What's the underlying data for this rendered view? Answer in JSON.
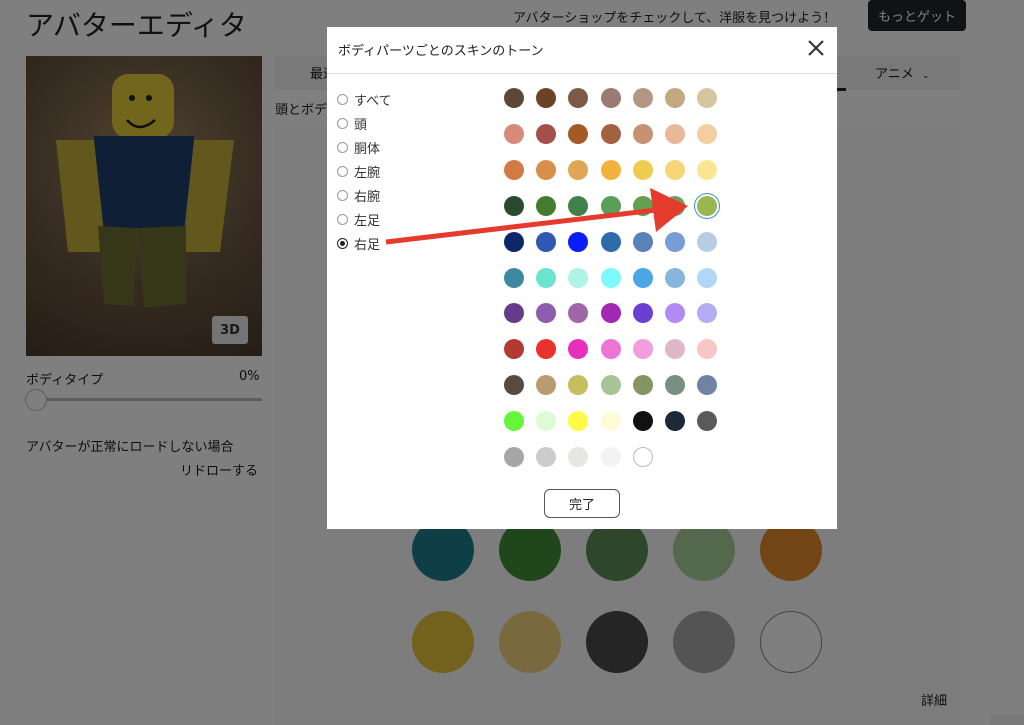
{
  "page": {
    "title": "アバターエディタ",
    "promo_text": "アバターショップをチェックして、洋服を見つけよう！",
    "get_more_label": "もっとゲット",
    "button_3d_label": "3D",
    "body_type_label": "ボディタイプ",
    "body_type_value": "0%",
    "load_fail_text": "アバターが正常にロードしない場合",
    "redraw_link": "リドローする",
    "tab_recent": "最近",
    "tab_anime": "アニメ",
    "subtab": "頭とボデ",
    "details_link": "詳細",
    "big_swatches": [
      {
        "color": "#1f7f8c"
      },
      {
        "color": "#3f8f36"
      },
      {
        "color": "#5c8c58"
      },
      {
        "color": "#a9d19b"
      },
      {
        "color": "#e68a2d"
      },
      {
        "color": "#e6c43a"
      },
      {
        "color": "#f2d27d"
      },
      {
        "color": "#4a4a4a"
      },
      {
        "color": "#a8a8a8"
      },
      {
        "color": "#ffffff"
      }
    ]
  },
  "modal": {
    "title": "ボディパーツごとのスキンのトーン",
    "done_label": "完了",
    "parts": [
      {
        "label": "すべて",
        "checked": false
      },
      {
        "label": "頭",
        "checked": false
      },
      {
        "label": "胴体",
        "checked": false
      },
      {
        "label": "左腕",
        "checked": false
      },
      {
        "label": "右腕",
        "checked": false
      },
      {
        "label": "左足",
        "checked": false
      },
      {
        "label": "右足",
        "checked": true
      }
    ],
    "swatch_rows": [
      [
        "#5e4638",
        "#6b4226",
        "#7c5a46",
        "#9b7a74",
        "#b49684",
        "#c3a880",
        "#d5c5a0"
      ],
      [
        "#d88a7a",
        "#a54f4b",
        "#a35a24",
        "#a0623f",
        "#c79272",
        "#e8b899",
        "#f4cea0"
      ],
      [
        "#d07a45",
        "#d88f4c",
        "#e0a655",
        "#f2b23c",
        "#f0cc4e",
        "#f6d778",
        "#fae691"
      ],
      [
        "#2a4a30",
        "#437c2e",
        "#3f8148",
        "#5a9f58",
        "#669e52",
        "#6f9c5e",
        "#9ab650"
      ],
      [
        "#0d2668",
        "#2f58b2",
        "#0a1dfb",
        "#2f6aad",
        "#5b82b8",
        "#799bd6",
        "#b6cde3"
      ],
      [
        "#3d8aa0",
        "#6ae3cf",
        "#aff2e8",
        "#7df8fb",
        "#4aa6e4",
        "#86b6dc",
        "#b2d6f6"
      ],
      [
        "#663b8b",
        "#8c5cae",
        "#a066a8",
        "#a227b2",
        "#6b3fd1",
        "#b38af3",
        "#b6acf4"
      ],
      [
        "#b33a33",
        "#ea322c",
        "#e72fbb",
        "#ec74d3",
        "#f19ddf",
        "#e1b6c6",
        "#f6c7c4"
      ],
      [
        "#584a3e",
        "#b89c70",
        "#c6bd5c",
        "#a6c596",
        "#859463",
        "#798f82",
        "#6f83a3"
      ],
      [
        "#66f53a",
        "#ddfbd6",
        "#fbfb47",
        "#fdfcd6",
        "#111111",
        "#1c2a38",
        "#5a5a5a"
      ],
      [
        "#a6a6a6",
        "#cccccc",
        "#e6e6e2",
        "#f3f3f3",
        "#ffffff"
      ]
    ],
    "selected_swatch": {
      "row": 3,
      "col": 6
    }
  },
  "annotation": {
    "color": "#e53b2c"
  }
}
